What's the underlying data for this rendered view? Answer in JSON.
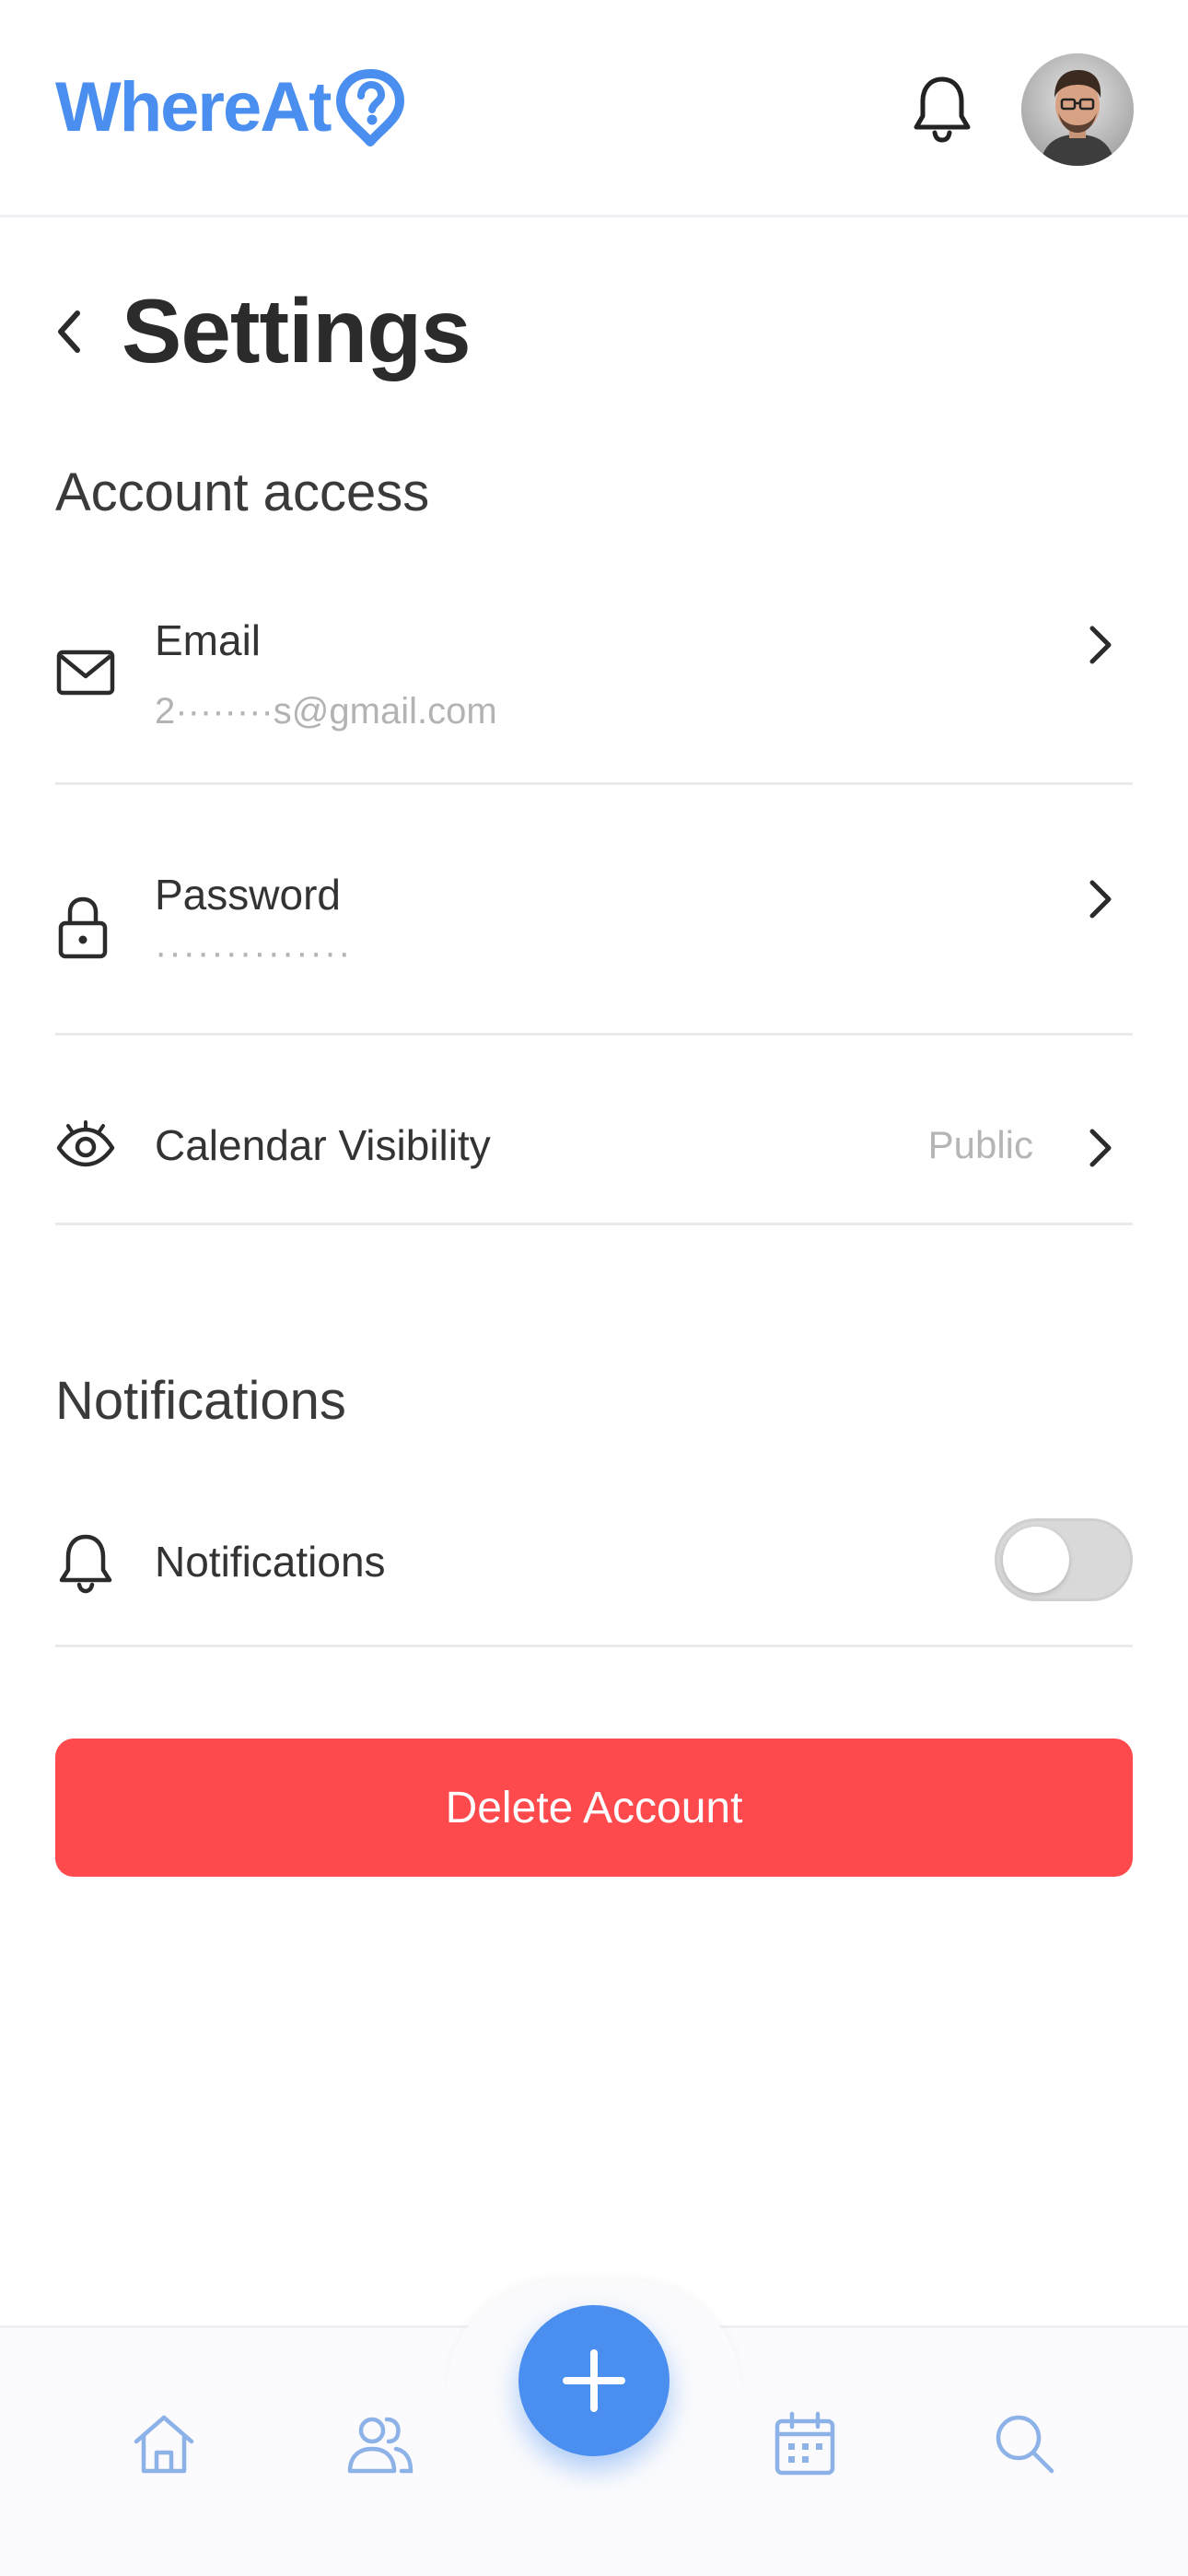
{
  "header": {
    "logo_text": "WhereAt",
    "logo_icon": "question-pin-icon",
    "notifications_icon": "bell-icon",
    "avatar_icon": "user-avatar"
  },
  "page": {
    "title": "Settings"
  },
  "account_access": {
    "heading": "Account access",
    "email": {
      "label": "Email",
      "value": "2········s@gmail.com"
    },
    "password": {
      "label": "Password",
      "value": "··············"
    },
    "calendar_visibility": {
      "label": "Calendar Visibility",
      "value": "Public"
    }
  },
  "notifications": {
    "heading": "Notifications",
    "toggle_label": "Notifications",
    "enabled": false
  },
  "actions": {
    "delete_label": "Delete Account"
  },
  "colors": {
    "brand": "#4a8ef0",
    "danger": "#fe4a4d",
    "divider": "#e9eaec"
  }
}
